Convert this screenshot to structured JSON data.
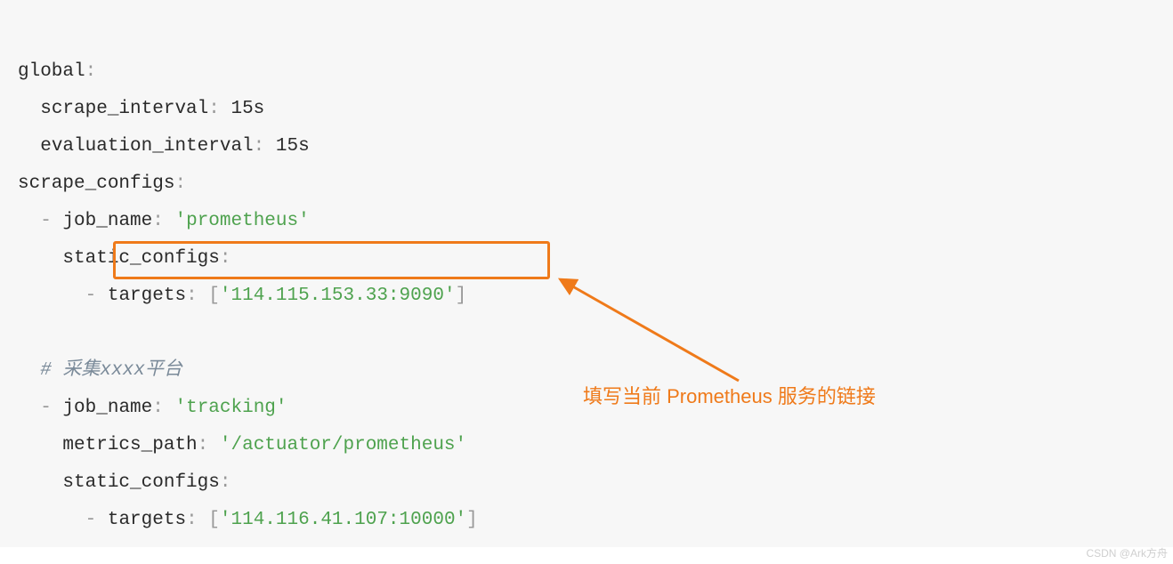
{
  "code": {
    "l1": {
      "key": "global",
      "colon": ":"
    },
    "l2": {
      "key": "scrape_interval",
      "colon": ":",
      "value": "15s"
    },
    "l3": {
      "key": "evaluation_interval",
      "colon": ":",
      "value": "15s"
    },
    "l4": {
      "key": "scrape_configs",
      "colon": ":"
    },
    "l5": {
      "dash": "-",
      "key": "job_name",
      "colon": ":",
      "q1": "'",
      "value": "prometheus",
      "q2": "'"
    },
    "l6": {
      "key": "static_configs",
      "colon": ":"
    },
    "l7": {
      "dash": "-",
      "key": "targets",
      "colon": ":",
      "lb": "[",
      "q1": "'",
      "value": "114.115.153.33:9090",
      "q2": "'",
      "rb": "]"
    },
    "l8": {
      "comment": "# 采集xxxx平台"
    },
    "l9": {
      "dash": "-",
      "key": "job_name",
      "colon": ":",
      "q1": "'",
      "value": "tracking",
      "q2": "'"
    },
    "l10": {
      "key": "metrics_path",
      "colon": ":",
      "q1": "'",
      "value": "/actuator/prometheus",
      "q2": "'"
    },
    "l11": {
      "key": "static_configs",
      "colon": ":"
    },
    "l12": {
      "dash": "-",
      "key": "targets",
      "colon": ":",
      "lb": "[",
      "q1": "'",
      "value": "114.116.41.107:10000",
      "q2": "'",
      "rb": "]"
    }
  },
  "annotation": {
    "text": "填写当前 Prometheus 服务的链接",
    "arrow_color": "#ef7a1a"
  },
  "watermark": "CSDN @Ark方舟"
}
